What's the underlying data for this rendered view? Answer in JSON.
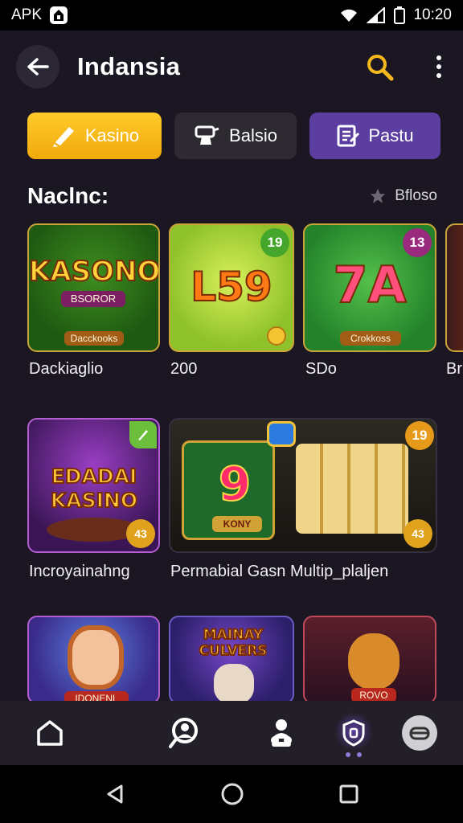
{
  "status_bar": {
    "carrier": "APK",
    "time": "10:20"
  },
  "header": {
    "title": "Indansia"
  },
  "chips": [
    {
      "label": "Kasino",
      "icon": "pen-icon"
    },
    {
      "label": "Balsio",
      "icon": "card-stand-icon"
    },
    {
      "label": "Pastu",
      "icon": "clipboard-icon"
    }
  ],
  "section": {
    "title": "Naclnc:",
    "right_label": "Bfloso"
  },
  "games_row1": [
    {
      "label": "Dackiaglio",
      "art_text": "KASONO",
      "art_sub": "BSOROR",
      "plate": "Dacckooks"
    },
    {
      "label": "200",
      "art_text": "L59",
      "badge": "19"
    },
    {
      "label": "SDo",
      "art_text": "7A",
      "badge": "13",
      "plate": "Crokkoss"
    },
    {
      "label": "Br"
    }
  ],
  "games_row2": [
    {
      "label": "Incroyainahng",
      "art_text": "EDADAI KASINO",
      "badge": "43"
    },
    {
      "label": "Permabial Gasn Multip_plaljen",
      "art_text": "9",
      "art_sub": "KONY",
      "badge": "19",
      "badge2": "43"
    }
  ],
  "games_row3": [
    {
      "art_text": "IDONENL"
    },
    {
      "art_text": "MAINAY CULVERS"
    },
    {
      "art_text": "ROVO"
    }
  ],
  "bottom_nav": [
    {
      "icon": "home-icon"
    },
    {
      "icon": "search-person-icon"
    },
    {
      "icon": "users-icon"
    },
    {
      "icon": "shield-icon",
      "active": true
    },
    {
      "icon": "support-icon"
    }
  ],
  "colors": {
    "background": "#1b1722",
    "accent_yellow": "#f5b81a",
    "accent_purple": "#5b3ea0"
  }
}
